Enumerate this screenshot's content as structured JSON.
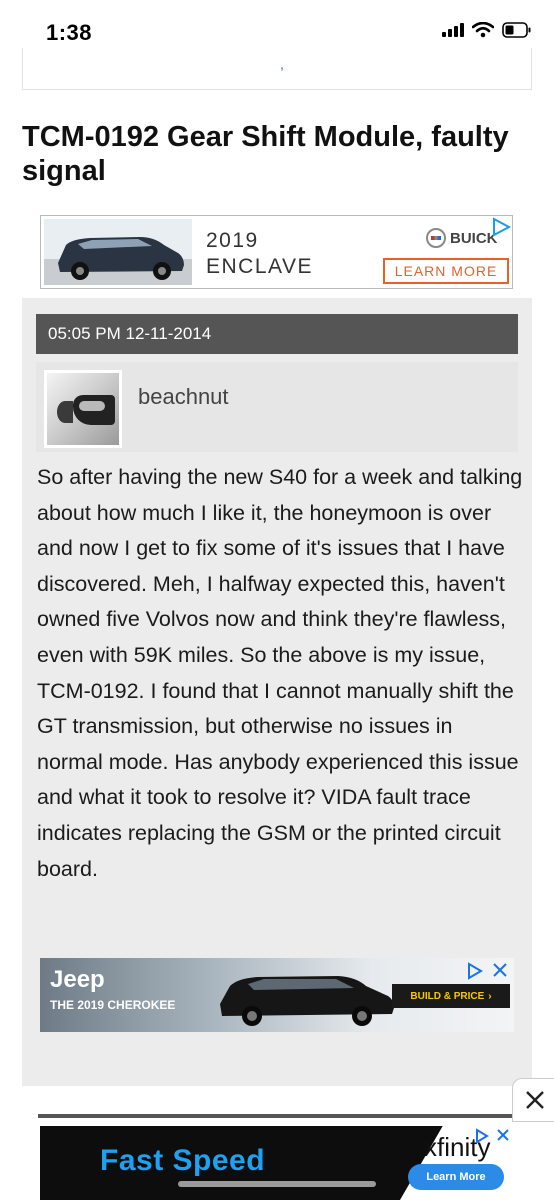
{
  "status_bar": {
    "time": "1:38"
  },
  "top_card": {
    "mark": ","
  },
  "article": {
    "title": "TCM-0192 Gear Shift Module, faulty signal"
  },
  "ads": {
    "enclave": {
      "year": "2019",
      "model": "ENCLAVE",
      "brand": "BUICK",
      "cta": "LEARN MORE"
    },
    "jeep": {
      "brand": "Jeep",
      "tagline": "THE 2019 CHEROKEE",
      "cta": "BUILD & PRICE",
      "cta_arrow": "›"
    },
    "bottom": {
      "headline": "Fast Speed",
      "brand": "xfinity",
      "cta": "Learn More"
    }
  },
  "post": {
    "timestamp": "05:05 PM 12-11-2014",
    "username": "beachnut",
    "body": "So after having the new S40 for a week and talking about how much I like it, the honeymoon is over and now I get to fix some of it's issues that I have discovered. Meh, I halfway expected this, haven't owned five Volvos now and think they're flawless, even with 59K miles. So the above is my issue, TCM-0192. I found that I cannot manually shift the GT transmission, but otherwise no issues in normal mode. Has anybody experienced this issue and what it took to resolve it? VIDA fault trace indicates replacing the GSM or the printed circuit board."
  },
  "controls": {
    "close_label": "✕"
  },
  "colors": {
    "post_header_bg": "#555555",
    "learn_more_accent": "#e2632d",
    "fast_speed_blue": "#1da1f2"
  },
  "icons": [
    "signal-icon",
    "wifi-icon",
    "battery-icon",
    "ad-choices-icon",
    "close-icon",
    "buick-logo-icon"
  ]
}
